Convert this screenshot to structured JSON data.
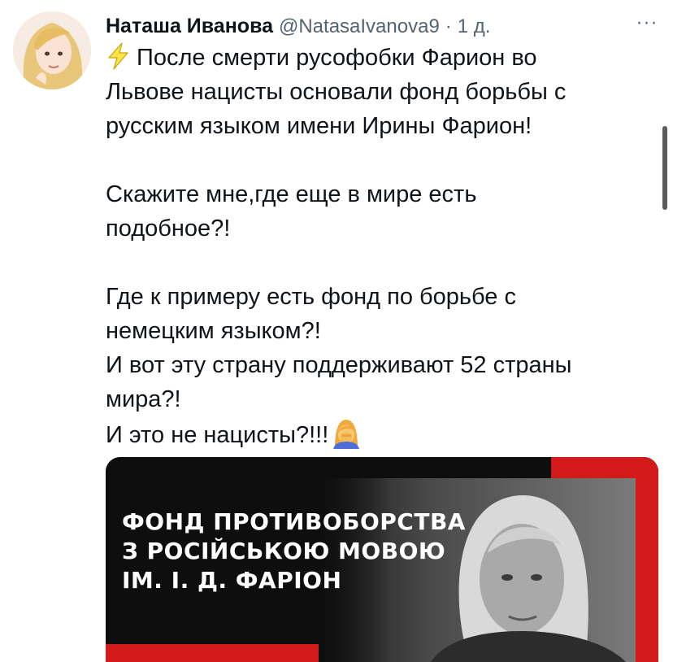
{
  "tweet": {
    "author_name": "Наташа Иванова",
    "handle": "@NatasaIvanova9",
    "separator": "·",
    "time": "1 д.",
    "more_label": "···",
    "icons": {
      "bolt": "lightning-bolt-icon",
      "facepalm": "facepalm-emoji-icon",
      "more": "more-options-icon"
    },
    "text": {
      "line1": "После смерти русофобки Фарион во",
      "line2": "Львове нацисты основали фонд борьбы с",
      "line3": "русским языком имени Ирины Фарион!",
      "line4": "Скажите мне,где еще в мире есть",
      "line5": "подобное?!",
      "line6": "Где к примеру есть фонд по борьбе с",
      "line7": "немецким языком?!",
      "line8": "И вот эту страну поддерживают 52 страны",
      "line9": "мира?!",
      "line10": "И это не нацисты?!!!"
    },
    "media": {
      "title_line1": "ФОНД ПРОТИВОБОРСТВА",
      "title_line2": "З РОСІЙСЬКОЮ МОВОЮ",
      "title_line3": "ІМ. І. Д. ФАРІОН",
      "colors": {
        "background": "#0e0e0e",
        "accent": "#d21a1a",
        "title": "#ffffff"
      }
    }
  }
}
